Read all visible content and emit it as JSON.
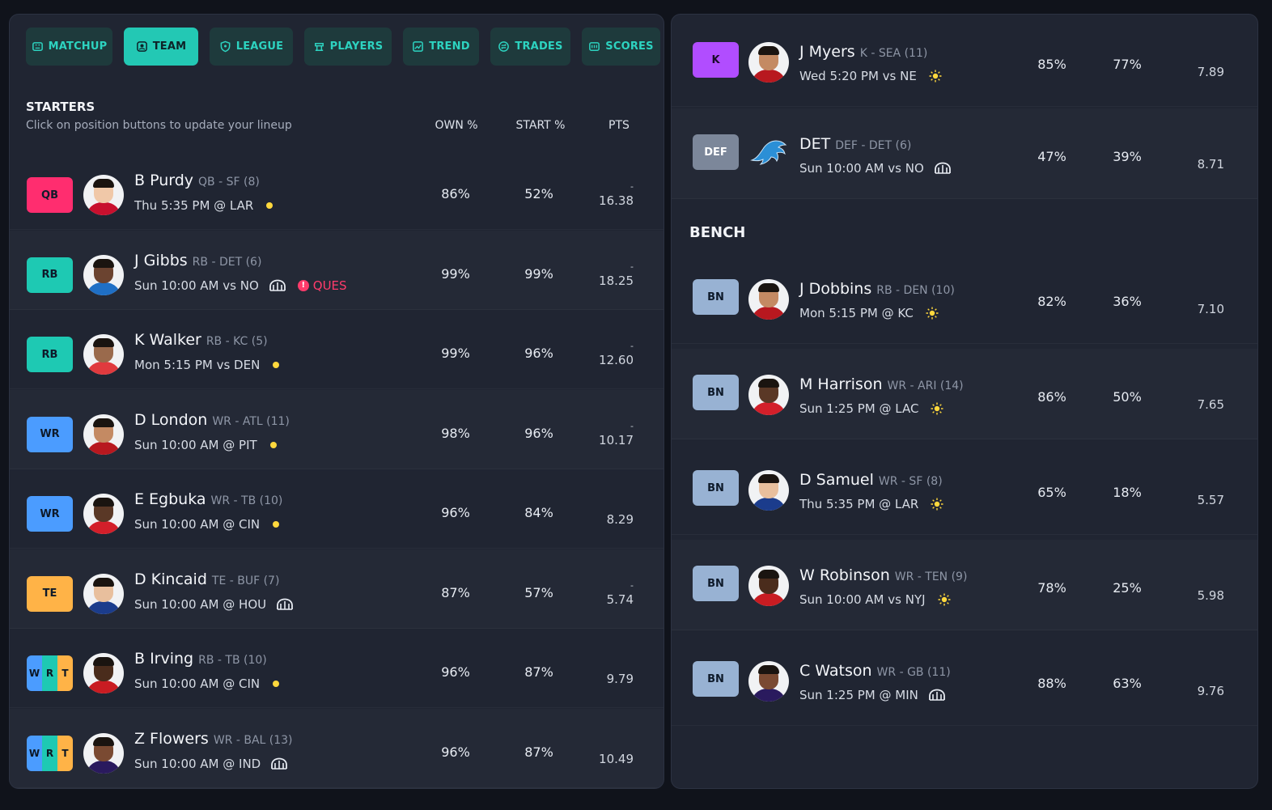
{
  "tabs": [
    {
      "label": "MATCHUP",
      "icon": "scoreboard-icon",
      "active": false
    },
    {
      "label": "TEAM",
      "icon": "team-icon",
      "active": true
    },
    {
      "label": "LEAGUE",
      "icon": "shield-icon",
      "active": false
    },
    {
      "label": "PLAYERS",
      "icon": "players-icon",
      "active": false
    },
    {
      "label": "TREND",
      "icon": "trend-icon",
      "active": false
    },
    {
      "label": "TRADES",
      "icon": "trades-icon",
      "active": false
    },
    {
      "label": "SCORES",
      "icon": "scores-icon",
      "active": false
    }
  ],
  "starters": {
    "title": "STARTERS",
    "subtitle": "Click on position buttons to update your lineup",
    "col_own": "OWN %",
    "col_start": "START %",
    "col_pts": "PTS",
    "players": [
      {
        "pos": "QB",
        "name": "B Purdy",
        "meta": "QB - SF (8)",
        "game": "Thu 5:35 PM @ LAR",
        "weather": "dot",
        "status": "",
        "own": "86%",
        "start": "52%",
        "pts": "16.38",
        "dash": "-"
      },
      {
        "pos": "RB",
        "name": "J Gibbs",
        "meta": "RB - DET (6)",
        "game": "Sun 10:00 AM vs NO",
        "weather": "dome",
        "status": "QUES",
        "own": "99%",
        "start": "99%",
        "pts": "18.25",
        "dash": "-"
      },
      {
        "pos": "RB",
        "name": "K Walker",
        "meta": "RB - KC (5)",
        "game": "Mon 5:15 PM vs DEN",
        "weather": "dot",
        "status": "",
        "own": "99%",
        "start": "96%",
        "pts": "12.60",
        "dash": "-"
      },
      {
        "pos": "WR",
        "name": "D London",
        "meta": "WR - ATL (11)",
        "game": "Sun 10:00 AM @ PIT",
        "weather": "dot",
        "status": "",
        "own": "98%",
        "start": "96%",
        "pts": "10.17",
        "dash": "-"
      },
      {
        "pos": "WR",
        "name": "E Egbuka",
        "meta": "WR - TB (10)",
        "game": "Sun 10:00 AM @ CIN",
        "weather": "dot",
        "status": "",
        "own": "96%",
        "start": "84%",
        "pts": "8.29",
        "dash": ""
      },
      {
        "pos": "TE",
        "name": "D Kincaid",
        "meta": "TE - BUF (7)",
        "game": "Sun 10:00 AM @ HOU",
        "weather": "dome",
        "status": "",
        "own": "87%",
        "start": "57%",
        "pts": "5.74",
        "dash": "-"
      },
      {
        "pos": "W R T",
        "name": "B Irving",
        "meta": "RB - TB (10)",
        "game": "Sun 10:00 AM @ CIN",
        "weather": "dot",
        "status": "",
        "own": "96%",
        "start": "87%",
        "pts": "9.79",
        "dash": ""
      },
      {
        "pos": "W R T",
        "name": "Z Flowers",
        "meta": "WR - BAL (13)",
        "game": "Sun 10:00 AM @ IND",
        "weather": "dome",
        "status": "",
        "own": "96%",
        "start": "87%",
        "pts": "10.49",
        "dash": ""
      }
    ]
  },
  "right_starters": [
    {
      "pos": "K",
      "name": "J Myers",
      "meta": "K - SEA (11)",
      "game": "Wed 5:20 PM vs NE",
      "weather": "sun",
      "own": "85%",
      "start": "77%",
      "pts": "7.89"
    },
    {
      "pos": "DEF",
      "name": "DET",
      "meta": "DEF - DET (6)",
      "game": "Sun 10:00 AM vs NO",
      "weather": "dome",
      "own": "47%",
      "start": "39%",
      "pts": "8.71"
    }
  ],
  "bench": {
    "title": "BENCH",
    "players": [
      {
        "pos": "BN",
        "name": "J Dobbins",
        "meta": "RB - DEN (10)",
        "game": "Mon 5:15 PM @ KC",
        "weather": "sun",
        "own": "82%",
        "start": "36%",
        "pts": "7.10"
      },
      {
        "pos": "BN",
        "name": "M Harrison",
        "meta": "WR - ARI (14)",
        "game": "Sun 1:25 PM @ LAC",
        "weather": "sun",
        "own": "86%",
        "start": "50%",
        "pts": "7.65"
      },
      {
        "pos": "BN",
        "name": "D Samuel",
        "meta": "WR - SF (8)",
        "game": "Thu 5:35 PM @ LAR",
        "weather": "sun",
        "own": "65%",
        "start": "18%",
        "pts": "5.57"
      },
      {
        "pos": "BN",
        "name": "W Robinson",
        "meta": "WR - TEN (9)",
        "game": "Sun 10:00 AM vs NYJ",
        "weather": "sun",
        "own": "78%",
        "start": "25%",
        "pts": "5.98"
      },
      {
        "pos": "BN",
        "name": "C Watson",
        "meta": "WR - GB (11)",
        "game": "Sun 1:25 PM @ MIN",
        "weather": "dome",
        "own": "88%",
        "start": "63%",
        "pts": "9.76"
      }
    ]
  },
  "colors": {
    "qb": "#ff2d6f",
    "rb": "#1ec9b3",
    "wr": "#4b9cff",
    "te": "#ffb347",
    "k": "#b14dff",
    "def": "#7c879a",
    "bn": "#98b2d3",
    "flex_w": "#4b9cff",
    "flex_r": "#1ec9b3",
    "flex_t": "#ffb347",
    "accent": "#23c8b4",
    "ques": "#ff3b6b"
  }
}
